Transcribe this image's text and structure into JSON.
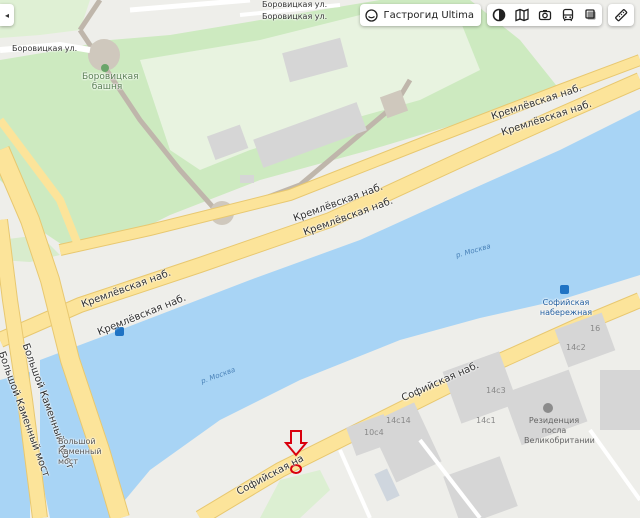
{
  "toolbar": {
    "guide_label": "Гастрогид Ultima",
    "icons": [
      "panorama-icon",
      "layers-map-icon",
      "photo-icon",
      "transit-icon",
      "map-type-icon",
      "ruler-icon"
    ]
  },
  "side_toggle": "◂",
  "streets": {
    "borovitskaya_1": "Боровицкая ул.",
    "borovitskaya_2": "Боровицкая ул.",
    "borovitskaya_top": "Боровицкая ул.",
    "kremlevskaya_top_1": "Кремлёвская наб.",
    "kremlevskaya_top_2": "Кремлёвская наб.",
    "kremlevskaya_mid_1": "Кремлёвская наб.",
    "kremlevskaya_mid_2": "Кремлёвская наб.",
    "kremlevskaya_left_1": "Кремлёвская наб.",
    "kremlevskaya_left_2": "Кремлёвская наб.",
    "sofiyskaya_1": "Софийская наб.",
    "sofiyskaya_2": "Софийская на",
    "kamenny_1": "Большой Каменный мост",
    "kamenny_2": "Большой Каменный мост"
  },
  "water": {
    "river_1": "р. Москва",
    "river_2": "р. Москва"
  },
  "poi": {
    "tower_name": "Боровицкая башня",
    "station": "Софийская набережная",
    "residence": "Резиденция посла Великобритании",
    "bridge_label": "Большой Каменный мост"
  },
  "buildings": [
    "16",
    "14с2",
    "14с3",
    "14с1",
    "14с14",
    "10с4"
  ],
  "colors": {
    "water": "#a8d4f5",
    "park": "#cdeac0",
    "road": "#fce49a",
    "road_edge": "#e8c870",
    "marker": "#d9000d"
  }
}
